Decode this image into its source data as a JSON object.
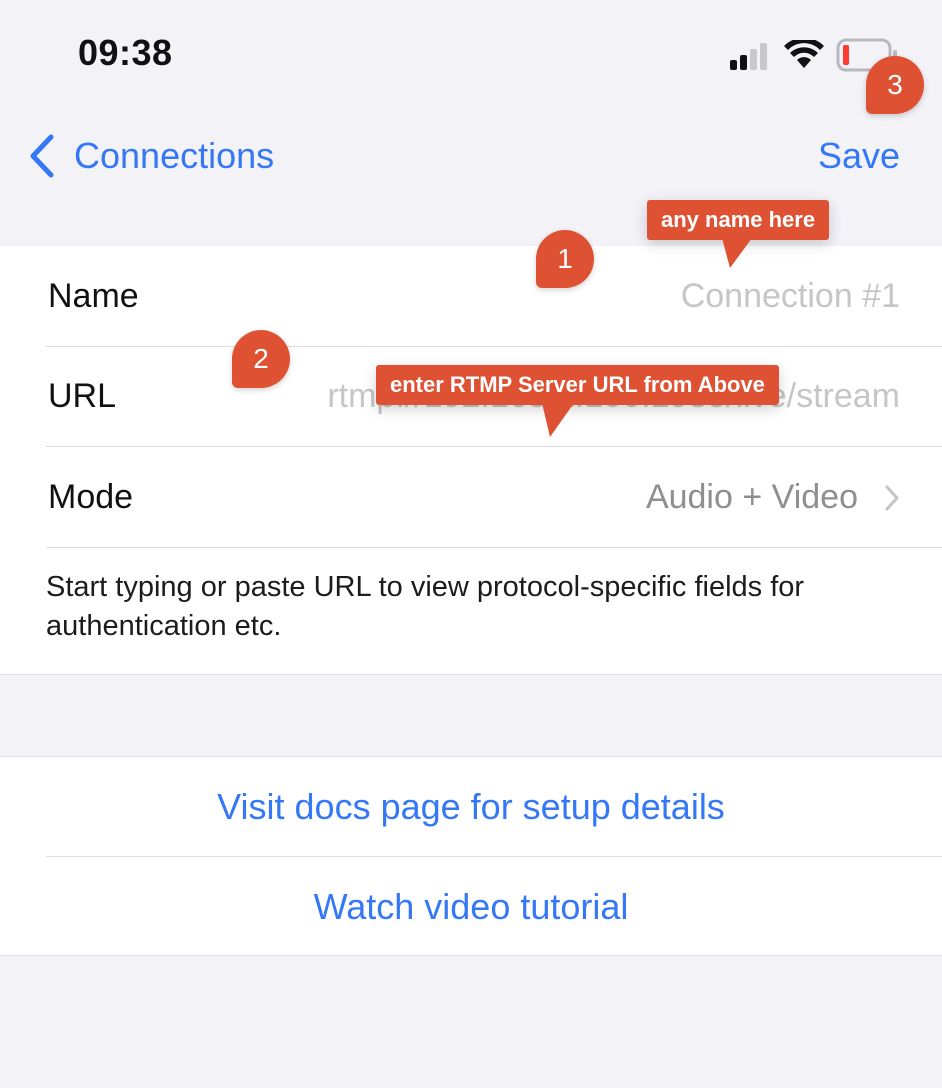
{
  "status_bar": {
    "time": "09:38",
    "icons": [
      "cellular-signal-icon",
      "wifi-icon",
      "battery-low-icon"
    ]
  },
  "nav": {
    "back_label": "Connections",
    "save_label": "Save"
  },
  "form": {
    "name": {
      "label": "Name",
      "placeholder": "Connection #1"
    },
    "url": {
      "label": "URL",
      "placeholder": "rtmp://192.168.1.100:1935/live/stream"
    },
    "mode": {
      "label": "Mode",
      "value": "Audio + Video"
    },
    "footer": "Start typing or paste URL to view protocol-specific fields for authentication etc."
  },
  "links": {
    "docs": "Visit docs page for setup details",
    "video": "Watch video tutorial"
  },
  "annotations": {
    "badge_1": "1",
    "badge_2": "2",
    "badge_3": "3",
    "callout_name": "any name here",
    "callout_url": "enter RTMP Server URL from Above"
  },
  "colors": {
    "accent": "#3478f6",
    "annotation": "#de5133",
    "background": "#f2f2f7",
    "battery_low": "#ff3b30"
  }
}
